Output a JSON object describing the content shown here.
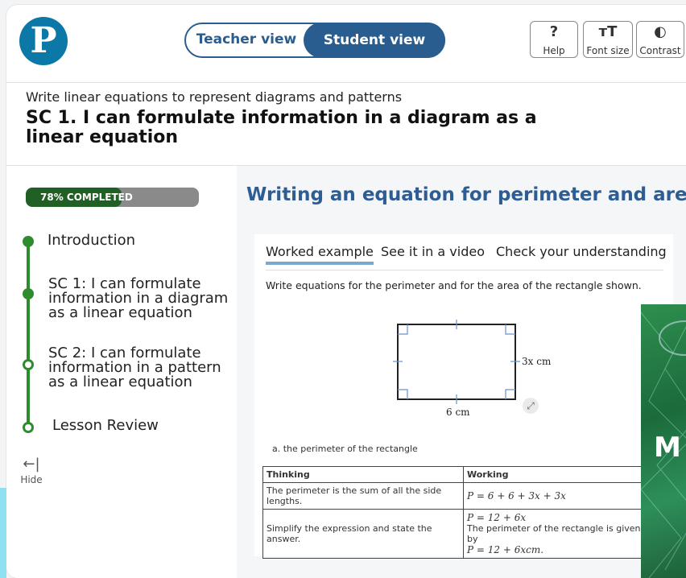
{
  "header": {
    "logo_text": "P",
    "view_toggle": {
      "teacher_label": "Teacher view",
      "student_label": "Student view",
      "selected": "Student view"
    },
    "tools": [
      {
        "icon": "question-icon",
        "glyph": "?",
        "label": "Help"
      },
      {
        "icon": "font-size-icon",
        "glyph": "ᴛT",
        "label": "Font size"
      },
      {
        "icon": "contrast-icon",
        "glyph": "◐",
        "label": "Contrast"
      }
    ]
  },
  "lesson": {
    "subtitle": "Write linear equations to represent diagrams and patterns",
    "title": "SC 1. I can formulate information in a diagram as a linear equation"
  },
  "sidebar": {
    "progress": {
      "percent": 78,
      "label": "78% COMPLETED"
    },
    "items": [
      {
        "label": "Introduction",
        "status": "complete"
      },
      {
        "label": "SC 1: I can formulate information in a diagram as a linear equation",
        "status": "current"
      },
      {
        "label": "SC 2: I can formulate information in a pattern as a linear equation",
        "status": "incomplete"
      },
      {
        "label": "Lesson Review",
        "status": "incomplete"
      }
    ],
    "hide_label": "Hide",
    "hide_icon": "arrow-left-icon"
  },
  "content": {
    "section_title": "Writing an equation for perimeter and area",
    "tabs": [
      {
        "label": "Worked example",
        "active": true
      },
      {
        "label": "See it in a video",
        "active": false
      },
      {
        "label": "Check your understanding",
        "active": false
      }
    ],
    "instruction": "Write equations for the perimeter and for the area of the rectangle shown.",
    "diagram": {
      "width_label": "6 cm",
      "height_label": "3x cm"
    },
    "question_a": "a. the perimeter of the rectangle",
    "table": {
      "headers": [
        "Thinking",
        "Working"
      ],
      "rows": [
        {
          "thinking": "The perimeter is the sum of all the side lengths.",
          "working": [
            "P = 6 + 6 + 3x + 3x"
          ]
        },
        {
          "thinking": "Simplify the expression and state the answer.",
          "working": [
            "P = 12 + 6x",
            "The perimeter of the rectangle is given by",
            "P = 12 + 6xcm."
          ]
        }
      ]
    },
    "overlay_text": "M"
  },
  "colors": {
    "brand_blue": "#2a5d8f",
    "logo_blue": "#0b78a8",
    "progress_green": "#216024",
    "track_green": "#2e8b2e",
    "title_blue": "#2e5d94"
  }
}
